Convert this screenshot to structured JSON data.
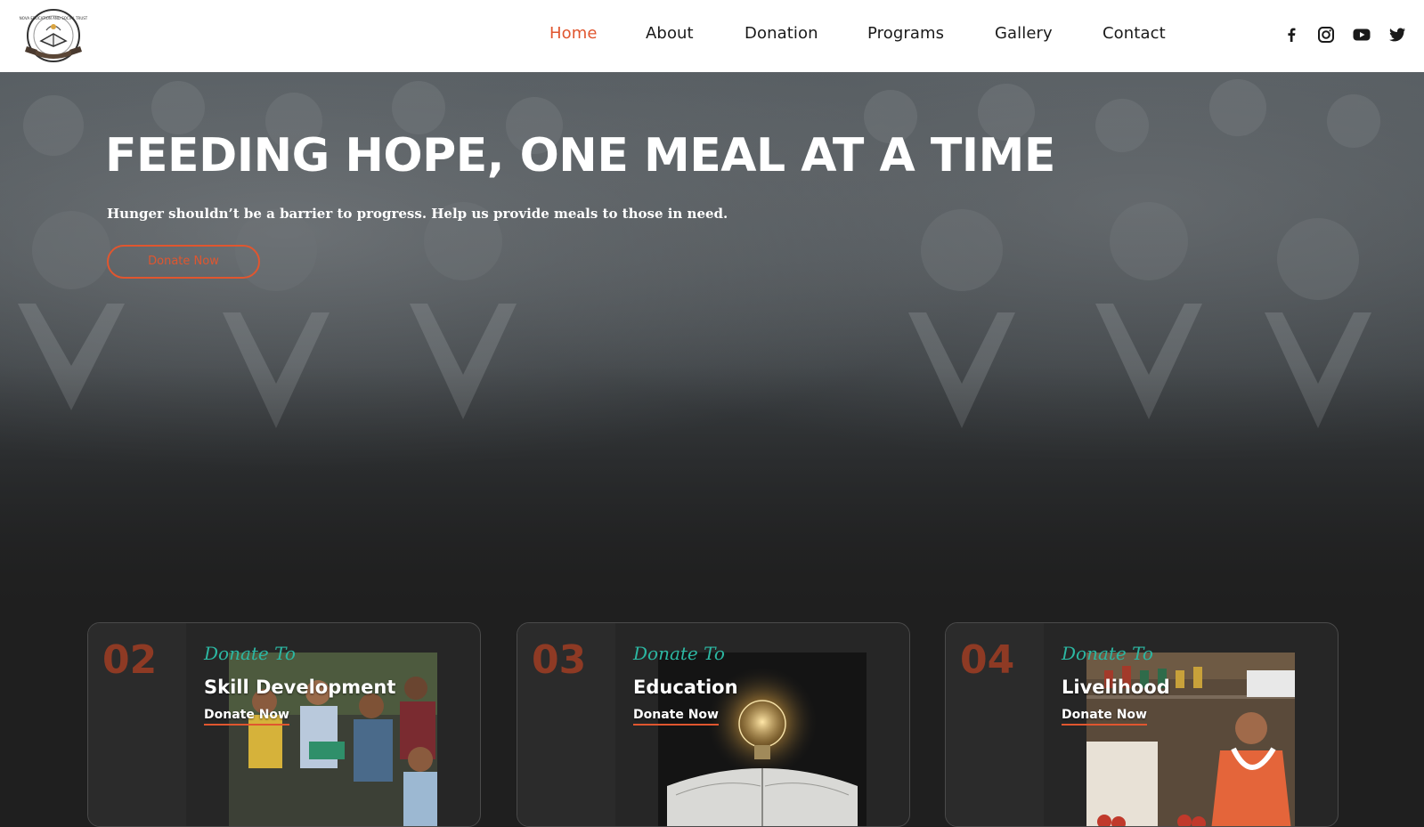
{
  "brand": {
    "logo_text": "NOVA EDUCATION AND SOCIAL TRUST"
  },
  "nav": {
    "items": [
      {
        "label": "Home",
        "active": true
      },
      {
        "label": "About",
        "active": false
      },
      {
        "label": "Donation",
        "active": false
      },
      {
        "label": "Programs",
        "active": false
      },
      {
        "label": "Gallery",
        "active": false
      },
      {
        "label": "Contact",
        "active": false
      }
    ]
  },
  "social": [
    "facebook-icon",
    "instagram-icon",
    "youtube-icon",
    "twitter-icon"
  ],
  "hero": {
    "title": "FEEDING HOPE, ONE MEAL AT A TIME",
    "subtitle": "Hunger shouldn’t be a barrier to progress. Help us provide meals to those in need.",
    "cta_label": "Donate Now"
  },
  "cards": [
    {
      "number": "02",
      "tag": "Donate To",
      "title": "Skill Development",
      "link_label": "Donate Now"
    },
    {
      "number": "03",
      "tag": "Donate To",
      "title": "Education",
      "link_label": "Donate Now"
    },
    {
      "number": "04",
      "tag": "Donate To",
      "title": "Livelihood",
      "link_label": "Donate Now"
    }
  ],
  "colors": {
    "accent": "#e0562f",
    "teal": "#2cb7a2",
    "card_number": "#8e3a24",
    "page_bg": "#1f1f1f"
  }
}
